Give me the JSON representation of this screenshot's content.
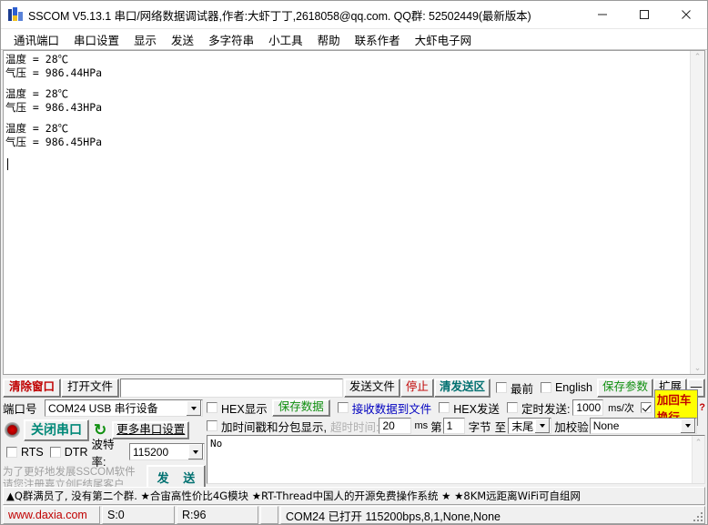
{
  "window": {
    "title": "SSCOM V5.13.1 串口/网络数据调试器,作者:大虾丁丁,2618058@qq.com. QQ群: 52502449(最新版本)",
    "minimize_label": "—",
    "maximize_label": "□",
    "close_label": "✕"
  },
  "menu": {
    "items": [
      {
        "label": "通讯端口"
      },
      {
        "label": "串口设置"
      },
      {
        "label": "显示"
      },
      {
        "label": "发送"
      },
      {
        "label": "多字符串"
      },
      {
        "label": "小工具"
      },
      {
        "label": "帮助"
      },
      {
        "label": "联系作者"
      },
      {
        "label": "大虾电子网"
      }
    ]
  },
  "terminal": {
    "blocks": [
      {
        "line1": "温度 = 28℃",
        "line2": "气压 = 986.44HPa"
      },
      {
        "line1": "温度 = 28℃",
        "line2": "气压 = 986.43HPa"
      },
      {
        "line1": "温度 = 28℃",
        "line2": "气压 = 986.45HPa"
      }
    ],
    "scroll_up": "⌃",
    "scroll_down": "⌄"
  },
  "toolbar": {
    "clear_window": "清除窗口",
    "open_file": "打开文件",
    "file_path_value": "",
    "send_file": "发送文件",
    "stop": "停止",
    "clear_send": "清发送区",
    "topmost_label": "最前",
    "topmost_checked": false,
    "english_label": "English",
    "english_checked": false,
    "save_params": "保存参数",
    "extend": "扩展",
    "minus": "—"
  },
  "port_panel": {
    "port_label": "端口号",
    "port_value": "COM24 USB 串行设备",
    "close_port_button": "关闭串口",
    "refresh_icon": "↻",
    "more_settings": "更多串口设置",
    "rts_label": "RTS",
    "rts_checked": false,
    "dtr_label": "DTR",
    "dtr_checked": false,
    "baud_label": "波特率:",
    "baud_value": "115200",
    "register_note_line1": "为了更好地发展SSCOM软件",
    "register_note_line2": "请您注册嘉立创F结尾客户",
    "send_button": "发  送"
  },
  "recv_panel": {
    "hex_display_label": "HEX显示",
    "hex_display_checked": false,
    "save_data_button": "保存数据",
    "recv_to_file_label": "接收数据到文件",
    "recv_to_file_checked": false,
    "hex_send_label": "HEX发送",
    "hex_send_checked": false,
    "timed_send_label": "定时发送:",
    "timed_send_checked": false,
    "timed_send_value": "1000",
    "timed_send_unit": "ms/次",
    "crlf_label": "加回车换行",
    "crlf_checked": true,
    "help_mark": "?",
    "timestamp_label": "加时间戳和分包显示,",
    "timestamp_checked": false,
    "timeout_label": "超时时间:",
    "timeout_value": "20",
    "timeout_unit": "ms",
    "byte_from_label": "第",
    "byte_from_value": "1",
    "byte_word_label": "字节",
    "byte_to_label": "至",
    "byte_end_value": "末尾",
    "checksum_label": "加校验",
    "checksum_value": "None"
  },
  "send_area": {
    "value": "No"
  },
  "adbar": {
    "text": "▲Q群满员了, 没有第二个群. ★合宙高性价比4G模块  ★RT-Thread中国人的开源免费操作系统 ★  ★8KM远距离WiFi可自组网"
  },
  "status": {
    "url": "www.daxia.com",
    "sent": "S:0",
    "received": "R:96",
    "blank": "",
    "connection": "COM24 已打开  115200bps,8,1,None,None"
  },
  "colors": {
    "red": "#c00000",
    "green": "#109010",
    "teal": "#007070",
    "blue": "#0000c0",
    "highlight": "#ffff00"
  }
}
